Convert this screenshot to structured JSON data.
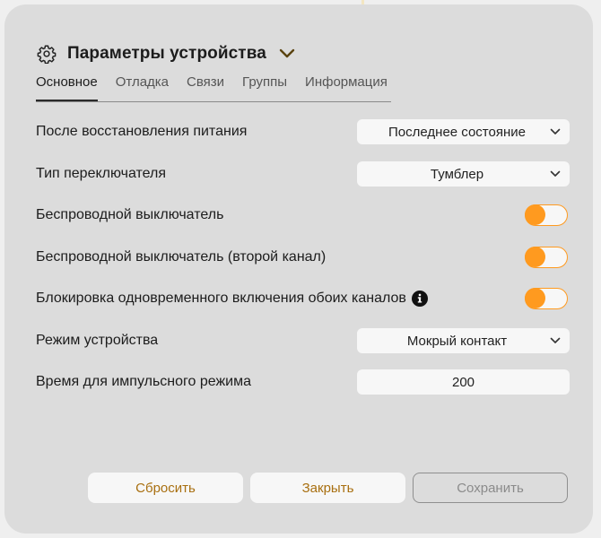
{
  "header": {
    "title": "Параметры устройства"
  },
  "tabs": [
    {
      "label": "Основное",
      "active": true
    },
    {
      "label": "Отладка",
      "active": false
    },
    {
      "label": "Связи",
      "active": false
    },
    {
      "label": "Группы",
      "active": false
    },
    {
      "label": "Информация",
      "active": false
    }
  ],
  "settings": {
    "power_restore": {
      "label": "После восстановления питания",
      "value": "Последнее состояние"
    },
    "switch_type": {
      "label": "Тип переключателя",
      "value": "Тумблер"
    },
    "wireless_switch": {
      "label": "Беспроводной выключатель",
      "on": true
    },
    "wireless_switch_ch2": {
      "label": "Беспроводной выключатель (второй канал)",
      "on": true
    },
    "interlock": {
      "label": "Блокировка одновременного включения обоих каналов",
      "on": true,
      "icon": "info-icon"
    },
    "device_mode": {
      "label": "Режим устройства",
      "value": "Мокрый контакт"
    },
    "pulse_time": {
      "label": "Время для импульсного режима",
      "value": "200"
    }
  },
  "buttons": {
    "reset": "Сбросить",
    "close": "Закрыть",
    "save": "Сохранить"
  },
  "colors": {
    "accent": "#ff9a1f",
    "button_text": "#a86f10",
    "dialog_bg": "#dcdcdc"
  }
}
